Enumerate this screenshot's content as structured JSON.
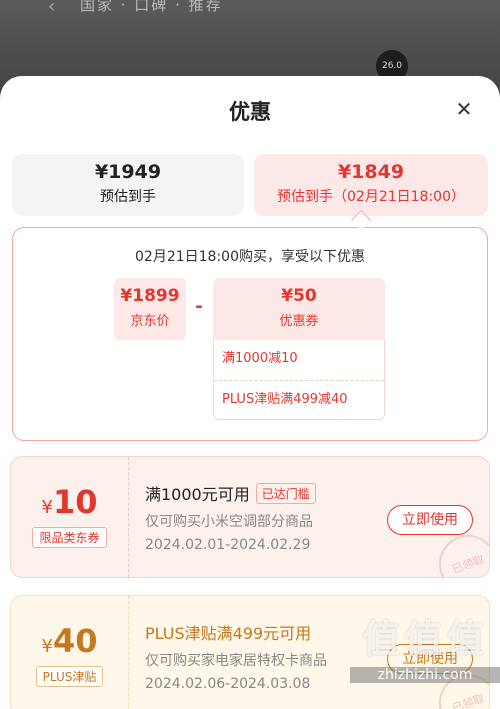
{
  "topbar": {
    "tabs": "国家 · 口碑 · 推荐 ",
    "badge": "26.0"
  },
  "sheet": {
    "title": "优惠"
  },
  "prices": [
    {
      "value": "¥1949",
      "label": "预估到手"
    },
    {
      "value": "¥1849",
      "label": "预估到手（02月21日18:00）"
    }
  ],
  "detail": {
    "header": "02月21日18:00购买，享受以下优惠",
    "jd_price": {
      "value": "¥1899",
      "label": "京东价"
    },
    "minus": "-",
    "coupon": {
      "value": "¥50",
      "label": "优惠券"
    },
    "coupon_items": [
      "满1000减10",
      "PLUS津贴满499减40"
    ]
  },
  "cards": [
    {
      "currency": "¥",
      "amount": "10",
      "tag": "限品类东券",
      "title": "满1000元可用",
      "reach": "已达门槛",
      "desc": "仅可购买小米空调部分商品",
      "date": "2024.02.01-2024.02.29",
      "button": "立即使用",
      "stamp": "已领取"
    },
    {
      "currency": "¥",
      "amount": "40",
      "tag": "PLUS津贴",
      "title": "PLUS津贴满499元可用",
      "desc": "仅可购买家电家居特权卡商品",
      "date": "2024.02.06-2024.03.08",
      "button": "立即使用",
      "stamp": "已领取"
    }
  ],
  "watermark": {
    "big": "值值值",
    "small": "zhizhizhi.com"
  }
}
